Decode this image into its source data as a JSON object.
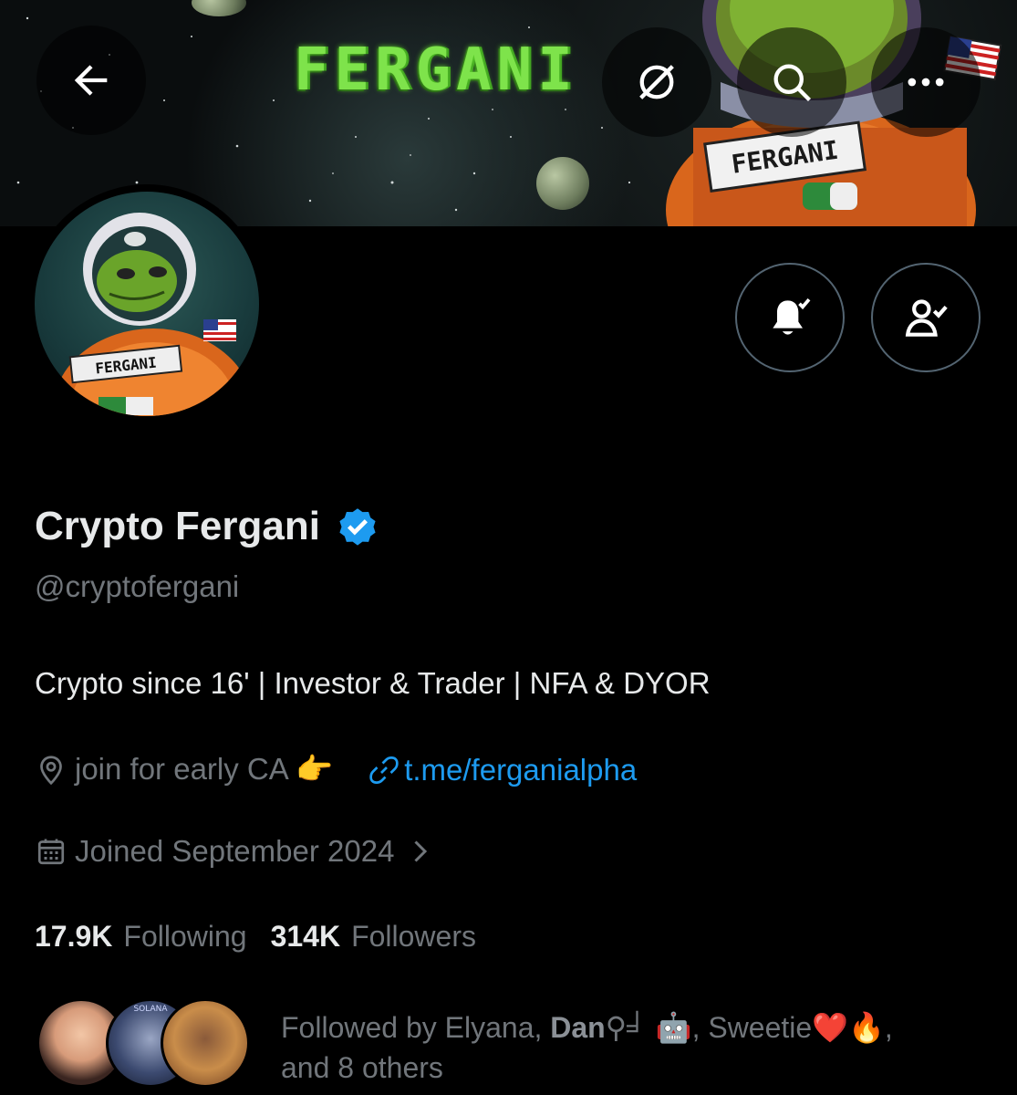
{
  "banner": {
    "title": "FERGANI"
  },
  "header": {
    "back_icon": "arrow-left-icon",
    "grok_icon": "slash-circle-icon",
    "search_icon": "search-icon",
    "more_icon": "more-dots-icon"
  },
  "actions": {
    "notify_icon": "bell-check-icon",
    "following_icon": "person-check-icon"
  },
  "profile": {
    "name": "Crypto Fergani",
    "handle": "@cryptofergani",
    "bio": "Crypto since 16' | Investor & Trader | NFA & DYOR",
    "location": "join for early CA 👉",
    "link": "t.me/ferganialpha",
    "joined": "Joined September 2024",
    "avatar_badge_text": "FERGANI"
  },
  "stats": {
    "following_count": "17.9K",
    "following_label": "Following",
    "followers_count": "314K",
    "followers_label": "Followers"
  },
  "followed_by": {
    "prefix": "Followed by Elyana, ",
    "bold_name": "Dan",
    "suffix_line1": "⚲╛ 🤖, Sweetie❤️🔥,",
    "line2": "and 8 others",
    "avatar2_label": "SOLANA"
  },
  "colors": {
    "accent": "#1d9bf0",
    "muted": "#71767b",
    "text": "#e7e9ea",
    "banner_title": "#7ee34b"
  }
}
